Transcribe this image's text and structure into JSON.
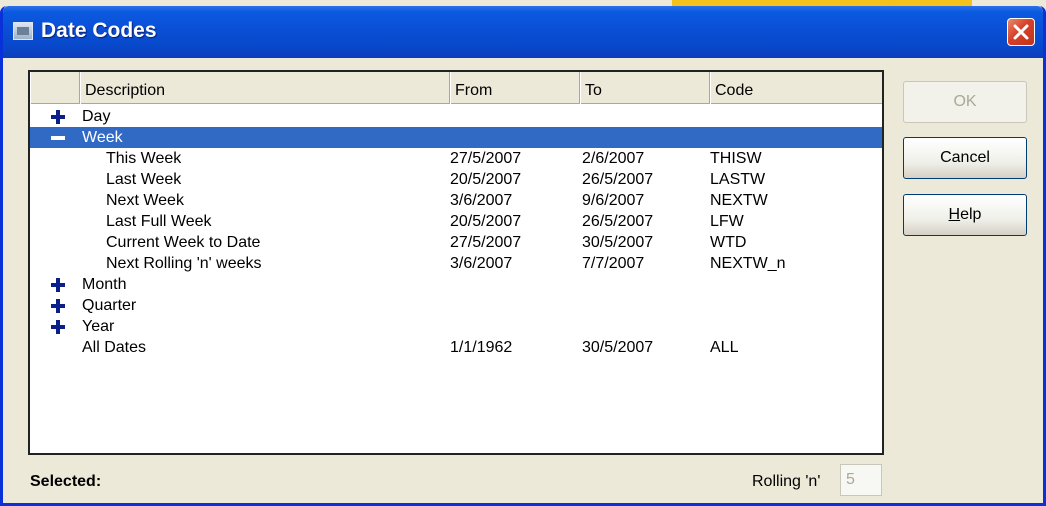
{
  "window": {
    "title": "Date Codes"
  },
  "list": {
    "columns": [
      "Description",
      "From",
      "To",
      "Code"
    ],
    "rows": [
      {
        "description": "Day",
        "from": "",
        "to": "",
        "code": "",
        "expander": "plus"
      },
      {
        "description": "Week",
        "from": "",
        "to": "",
        "code": "",
        "expander": "minus",
        "selected": true
      },
      {
        "description": "This Week",
        "from": "27/5/2007",
        "to": "2/6/2007",
        "code": "THISW"
      },
      {
        "description": "Last Week",
        "from": "20/5/2007",
        "to": "26/5/2007",
        "code": "LASTW"
      },
      {
        "description": "Next Week",
        "from": "3/6/2007",
        "to": "9/6/2007",
        "code": "NEXTW"
      },
      {
        "description": "Last Full Week",
        "from": "20/5/2007",
        "to": "26/5/2007",
        "code": "LFW"
      },
      {
        "description": "Current Week to Date",
        "from": "27/5/2007",
        "to": "30/5/2007",
        "code": "WTD"
      },
      {
        "description": "Next Rolling 'n' weeks",
        "from": "3/6/2007",
        "to": "7/7/2007",
        "code": "NEXTW_n"
      },
      {
        "description": "Month",
        "from": "",
        "to": "",
        "code": "",
        "expander": "plus"
      },
      {
        "description": "Quarter",
        "from": "",
        "to": "",
        "code": "",
        "expander": "plus"
      },
      {
        "description": "Year",
        "from": "",
        "to": "",
        "code": "",
        "expander": "plus"
      },
      {
        "description": "All Dates",
        "from": "1/1/1962",
        "to": "30/5/2007",
        "code": "ALL"
      }
    ]
  },
  "buttons": {
    "ok": {
      "label": "OK",
      "enabled": false
    },
    "cancel": {
      "label": "Cancel",
      "enabled": true
    },
    "help": {
      "label": "Help",
      "mnemonic": "H",
      "enabled": true
    }
  },
  "footer": {
    "selected_label": "Selected:",
    "rolling_label": "Rolling 'n'",
    "rolling_value": "5"
  },
  "colors": {
    "selection": "#316ac5",
    "titlebar": "#0a4fd6",
    "close_button": "#d6402a",
    "expander_icon": "#0a1f8a"
  },
  "icons": {
    "window": "application-icon",
    "close": "close-icon",
    "expand": "plus-icon",
    "collapse": "minus-icon"
  }
}
